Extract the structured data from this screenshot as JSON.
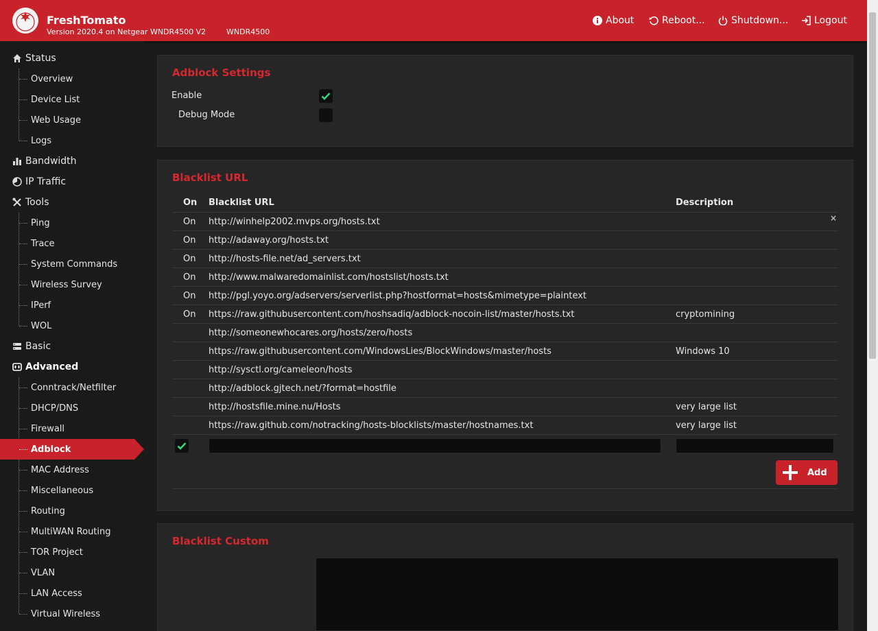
{
  "header": {
    "title": "FreshTomato",
    "version": "Version 2020.4 on Netgear WNDR4500 V2",
    "model": "WNDR4500",
    "buttons": {
      "about": "About",
      "reboot": "Reboot...",
      "shutdown": "Shutdown...",
      "logout": "Logout"
    }
  },
  "sidebar": {
    "status": {
      "label": "Status",
      "items": [
        "Overview",
        "Device List",
        "Web Usage",
        "Logs"
      ]
    },
    "bandwidth": "Bandwidth",
    "ip_traffic": "IP Traffic",
    "tools": {
      "label": "Tools",
      "items": [
        "Ping",
        "Trace",
        "System Commands",
        "Wireless Survey",
        "IPerf",
        "WOL"
      ]
    },
    "basic": "Basic",
    "advanced": {
      "label": "Advanced",
      "items": [
        "Conntrack/Netfilter",
        "DHCP/DNS",
        "Firewall",
        "Adblock",
        "MAC Address",
        "Miscellaneous",
        "Routing",
        "MultiWAN Routing",
        "TOR Project",
        "VLAN",
        "LAN Access",
        "Virtual Wireless"
      ],
      "active": "Adblock"
    }
  },
  "adblock_settings": {
    "title": "Adblock Settings",
    "enable_label": "Enable",
    "enable_checked": true,
    "debug_label": "Debug Mode",
    "debug_checked": false
  },
  "blacklist": {
    "title": "Blacklist URL",
    "columns": {
      "on": "On",
      "url": "Blacklist URL",
      "desc": "Description"
    },
    "rows": [
      {
        "on": "On",
        "url": "http://winhelp2002.mvps.org/hosts.txt",
        "desc": ""
      },
      {
        "on": "On",
        "url": "http://adaway.org/hosts.txt",
        "desc": ""
      },
      {
        "on": "On",
        "url": "http://hosts-file.net/ad_servers.txt",
        "desc": ""
      },
      {
        "on": "On",
        "url": "http://www.malwaredomainlist.com/hostslist/hosts.txt",
        "desc": ""
      },
      {
        "on": "On",
        "url": "http://pgl.yoyo.org/adservers/serverlist.php?hostformat=hosts&mimetype=plaintext",
        "desc": ""
      },
      {
        "on": "On",
        "url": "https://raw.githubusercontent.com/hoshsadiq/adblock-nocoin-list/master/hosts.txt",
        "desc": "cryptomining"
      },
      {
        "on": "",
        "url": "http://someonewhocares.org/hosts/zero/hosts",
        "desc": ""
      },
      {
        "on": "",
        "url": "https://raw.githubusercontent.com/WindowsLies/BlockWindows/master/hosts",
        "desc": "Windows 10"
      },
      {
        "on": "",
        "url": "http://sysctl.org/cameleon/hosts",
        "desc": ""
      },
      {
        "on": "",
        "url": "http://adblock.gjtech.net/?format=hostfile",
        "desc": ""
      },
      {
        "on": "",
        "url": "http://hostsfile.mine.nu/Hosts",
        "desc": "very large list"
      },
      {
        "on": "",
        "url": "https://raw.github.com/notracking/hosts-blocklists/master/hostnames.txt",
        "desc": "very large list"
      }
    ],
    "new_row": {
      "on_checked": true,
      "url_value": "",
      "desc_value": ""
    },
    "add_label": "Add",
    "delete_symbol": "×"
  },
  "blacklist_custom": {
    "title": "Blacklist Custom"
  },
  "colors": {
    "accent": "#c8232a",
    "title": "#d6282f",
    "bg": "#1b1b1b",
    "panel": "#262626",
    "check": "#3bd47a"
  }
}
